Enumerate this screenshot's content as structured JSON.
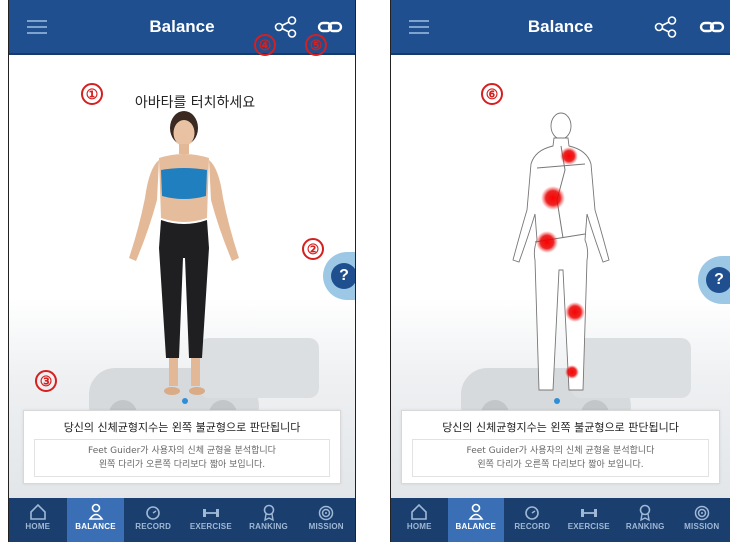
{
  "colors": {
    "header_bg": "#1f4f8f",
    "nav_bg": "#1a3e6e",
    "nav_active": "#3a6fb5",
    "marker_red": "#d61f1f",
    "help_tab": "#9cc8e6",
    "pain_red": "#e60000"
  },
  "left_screen": {
    "header": {
      "title": "Balance",
      "menu_icon": "hamburger-icon",
      "share_icon": "share-icon",
      "link_icon": "link-icon"
    },
    "instruction": "아바타를 터치하세요",
    "markers": [
      "①",
      "②",
      "③",
      "④",
      "⑤"
    ],
    "help_label": "?",
    "result": {
      "main": "당신의 신체균형지수는 왼쪽 불균형으로 판단됩니다",
      "sub_line1": "Feet Guider가 사용자의 신체 균형을 분석합니다",
      "sub_line2": "왼쪽 다리가 오른쪽 다리보다 짧아 보입니다."
    }
  },
  "right_screen": {
    "header": {
      "title": "Balance",
      "menu_icon": "hamburger-icon",
      "share_icon": "share-icon",
      "link_icon": "link-icon"
    },
    "markers": [
      "⑥"
    ],
    "help_label": "?",
    "result": {
      "main": "당신의 신체균형지수는 왼쪽 불균형으로 판단됩니다",
      "sub_line1": "Feet Guider가 사용자의 신체 균형을 분석합니다",
      "sub_line2": "왼쪽 다리가 오른쪽 다리보다 짧아 보입니다."
    }
  },
  "nav": {
    "items": [
      {
        "label": "HOME",
        "icon": "home-icon"
      },
      {
        "label": "BALANCE",
        "icon": "person-icon",
        "active": true
      },
      {
        "label": "RECORD",
        "icon": "clock-icon"
      },
      {
        "label": "EXERCISE",
        "icon": "dumbbell-icon"
      },
      {
        "label": "RANKING",
        "icon": "medal-icon"
      },
      {
        "label": "MISSION",
        "icon": "target-icon"
      }
    ]
  }
}
